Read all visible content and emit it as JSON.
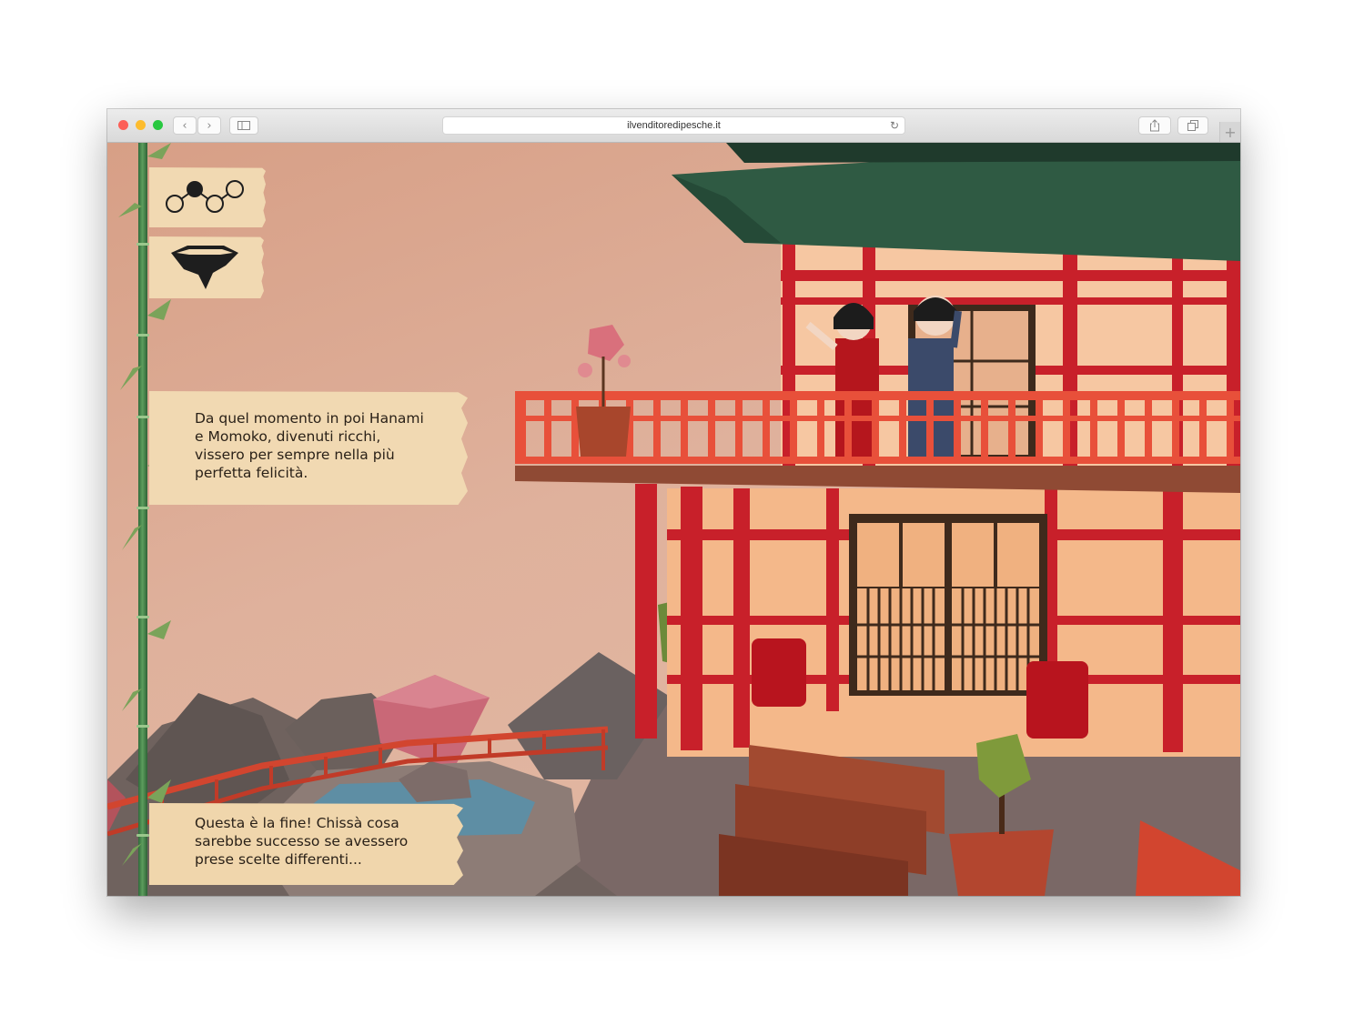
{
  "browser": {
    "url": "ilvenditoredipesche.it",
    "back_glyph": "‹",
    "forward_glyph": "›",
    "reload_glyph": "↻",
    "new_tab_glyph": "+"
  },
  "game": {
    "nav_icons": [
      "story-path-icon",
      "floating-island-icon"
    ],
    "story_text": "Da quel momento in poi Hanami\ne Momoko, divenuti ricchi,\nvissero per sempre nella più\nperfetta felicità.",
    "ending_text": "Questa è la fine! Chissà cosa\nsarebbe successo se avessero\nprese scelte differenti..."
  },
  "colors": {
    "sky": "#dfb19c",
    "roof": "#2f5a43",
    "timber": "#c8202a",
    "railing": "#e8503a",
    "wall": "#f4b88a",
    "rock": "#7a6a66",
    "panel": "#f1d9b2",
    "bamboo": "#4a8a4c"
  }
}
